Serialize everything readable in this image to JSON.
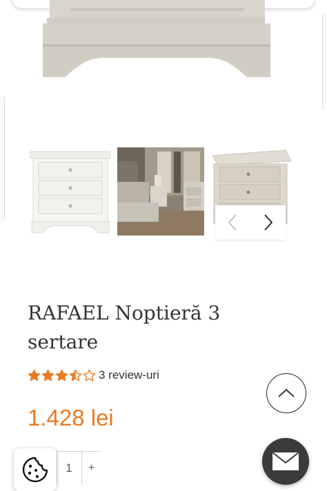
{
  "product": {
    "title": "RAFAEL Noptieră 3 sertare",
    "rating": 3.5,
    "rating_max": 5,
    "reviews_label": "3 review-uri",
    "price": "1.428 lei"
  },
  "gallery": {
    "thumbnails": [
      "nightstand-white",
      "bedroom-scene",
      "nightstand-grey"
    ],
    "prev_icon": "chevron-left-icon",
    "next_icon": "chevron-right-icon"
  },
  "cart": {
    "quantity": "1",
    "plus_label": "+"
  },
  "colors": {
    "price": "#ea7a22",
    "star": "#ea7a22",
    "mail_button": "#3b3b3b"
  },
  "icons": {
    "cookie": "cookie-icon",
    "mail": "envelope-icon",
    "scroll_top": "chevron-up-icon"
  }
}
